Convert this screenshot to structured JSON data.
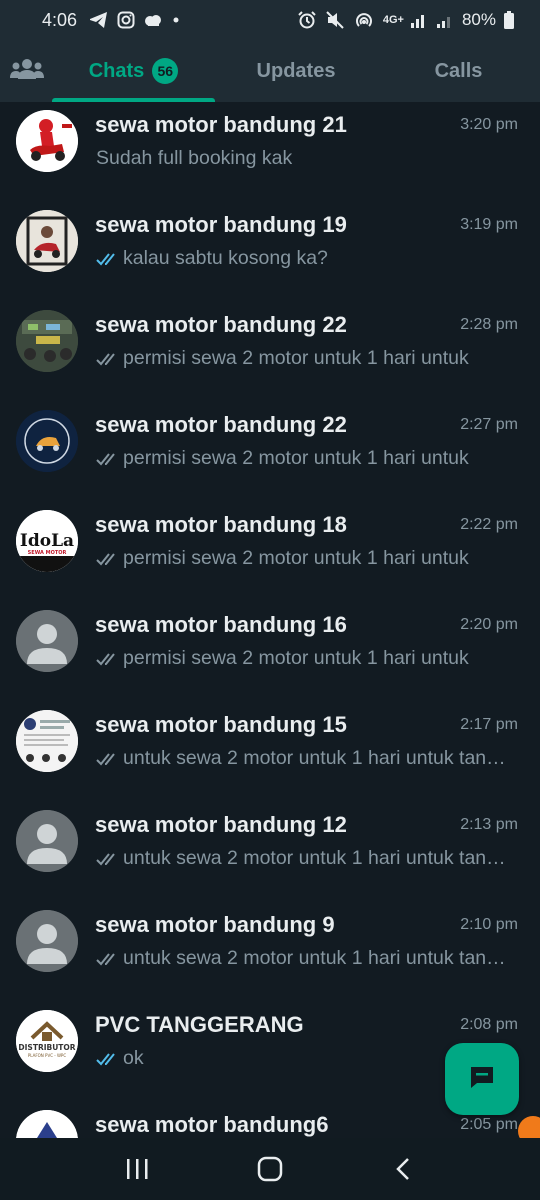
{
  "status_bar": {
    "time": "4:06",
    "network": "4G+",
    "battery": "80%",
    "icons": [
      "telegram-icon",
      "instagram-icon",
      "weather-icon",
      "dot-icon",
      "alarm-icon",
      "mute-icon",
      "hotspot-icon",
      "signal-icon",
      "battery-icon"
    ]
  },
  "tabs": {
    "community_icon": "community-icon",
    "chats": {
      "label": "Chats",
      "badge": "56",
      "active": true
    },
    "updates": {
      "label": "Updates"
    },
    "calls": {
      "label": "Calls"
    }
  },
  "colors": {
    "accent": "#00a884",
    "background": "#121b22",
    "header": "#1f2c34",
    "read_tick": "#53bdeb",
    "sent_tick": "#8696a0"
  },
  "chats": [
    {
      "name": "sewa motor bandung 21",
      "time": "3:20 pm",
      "preview": "Sudah full booking kak",
      "ticks": "none",
      "avatar": "scooter-red"
    },
    {
      "name": "sewa motor bandung 19",
      "time": "3:19 pm",
      "preview": "kalau sabtu kosong ka?",
      "ticks": "read",
      "avatar": "scooter-framed"
    },
    {
      "name": "sewa motor bandung 22",
      "time": "2:28 pm",
      "preview": "permisi sewa 2 motor untuk 1 hari untuk",
      "ticks": "delivered",
      "avatar": "garage-photo"
    },
    {
      "name": "sewa motor bandung 22",
      "time": "2:27 pm",
      "preview": "permisi sewa 2 motor untuk 1 hari untuk",
      "ticks": "delivered",
      "avatar": "navy-logo"
    },
    {
      "name": "sewa motor bandung 18",
      "time": "2:22 pm",
      "preview": "permisi sewa 2 motor untuk 1 hari untuk",
      "ticks": "delivered",
      "avatar": "idola-logo",
      "logo_text": "IdoLa",
      "logo_sub": "SEWA MOTOR"
    },
    {
      "name": "sewa motor bandung 16",
      "time": "2:20 pm",
      "preview": "permisi sewa 2 motor untuk 1 hari untuk",
      "ticks": "delivered",
      "avatar": "default"
    },
    {
      "name": "sewa motor bandung 15",
      "time": "2:17 pm",
      "preview": "untuk sewa 2 motor untuk 1 hari untuk tanggal",
      "ticks": "delivered",
      "avatar": "profile-screenshot"
    },
    {
      "name": "sewa motor bandung 12",
      "time": "2:13 pm",
      "preview": "untuk sewa 2 motor untuk 1 hari untuk tanggal",
      "ticks": "delivered",
      "avatar": "default"
    },
    {
      "name": "sewa motor bandung 9",
      "time": "2:10 pm",
      "preview": "untuk sewa 2 motor untuk 1 hari untuk tanggal",
      "ticks": "delivered",
      "avatar": "default"
    },
    {
      "name": "PVC TANGGERANG",
      "time": "2:08 pm",
      "preview": "ok",
      "ticks": "read",
      "avatar": "distributor-logo",
      "logo_text": "DISTRIBUTOR",
      "logo_sub": "PLAFON PVC - WPC"
    },
    {
      "name": "sewa motor bandung6",
      "time": "2:05 pm",
      "preview": "",
      "ticks": "none",
      "avatar": "athena-logo"
    }
  ],
  "fab": {
    "icon": "new-chat-icon"
  },
  "nav_bar": {
    "icons": [
      "recent-apps-icon",
      "home-icon",
      "back-icon"
    ]
  }
}
